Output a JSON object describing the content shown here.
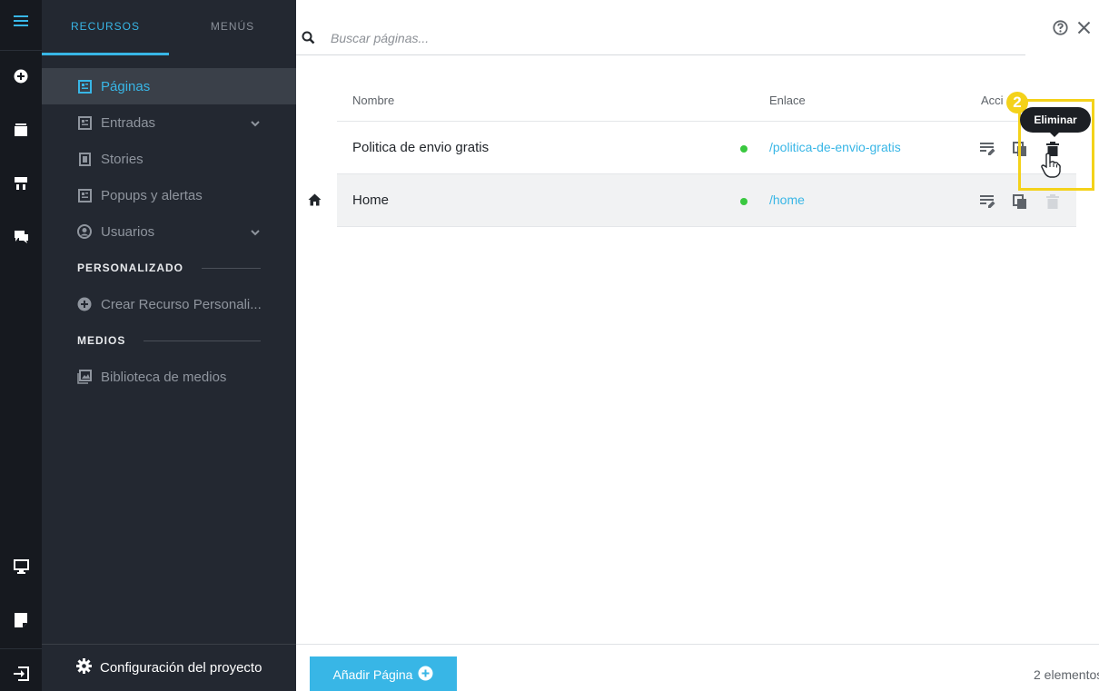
{
  "sidebar": {
    "tabs": [
      {
        "label": "RECURSOS"
      },
      {
        "label": "MENÚS"
      }
    ],
    "items": [
      {
        "label": "Páginas"
      },
      {
        "label": "Entradas"
      },
      {
        "label": "Stories"
      },
      {
        "label": "Popups y alertas"
      },
      {
        "label": "Usuarios"
      }
    ],
    "custom_section": {
      "title": "PERSONALIZADO",
      "create_label": "Crear Recurso Personali..."
    },
    "media_section": {
      "title": "MEDIOS",
      "library_label": "Biblioteca de medios"
    },
    "config_label": "Configuración del proyecto"
  },
  "search": {
    "placeholder": "Buscar páginas..."
  },
  "table": {
    "columns": {
      "name": "Nombre",
      "link": "Enlace",
      "actions": "Acci"
    },
    "rows": [
      {
        "name": "Politica de envio gratis",
        "link": "/politica-de-envio-gratis"
      },
      {
        "name": "Home",
        "link": "/home"
      }
    ]
  },
  "tooltip": {
    "label": "Eliminar"
  },
  "step_badge": "2",
  "footer": {
    "add_label": "Añadir Página",
    "count": "2 elementos"
  },
  "colors": {
    "accent": "#38b6e6",
    "highlight": "#f4d21a",
    "status_ok": "#39c83f"
  }
}
